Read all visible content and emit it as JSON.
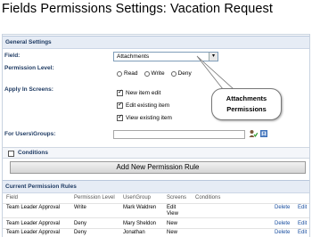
{
  "page": {
    "title": "Fields Permissions Settings: Vacation Request"
  },
  "general": {
    "heading": "General Settings",
    "field_label": "Field:",
    "field_value": "Attachments",
    "permission_label": "Permission Level:",
    "permission_options": [
      "Read",
      "Write",
      "Deny"
    ],
    "apply_label": "Apply In Screens:",
    "screens": [
      {
        "label": "New item edit",
        "checked": true
      },
      {
        "label": "Edit existing item",
        "checked": true
      },
      {
        "label": "View existing item",
        "checked": true
      }
    ],
    "users_label": "For Users\\Groups:"
  },
  "callout": {
    "line1": "Attachments",
    "line2": "Permissions"
  },
  "conditions": {
    "label": "Conditions"
  },
  "add_rule": {
    "label": "Add New Permission Rule"
  },
  "rules": {
    "heading": "Current Permission Rules",
    "columns": [
      "Field",
      "Permission Level",
      "User\\Group",
      "Screens",
      "Conditions"
    ],
    "rows": [
      {
        "field": "Team Leader Approval",
        "level": "Write",
        "user": "Mark Waldren",
        "screens1": "Edit",
        "screens2": "View",
        "delete": "Delete",
        "edit": "Edit"
      },
      {
        "field": "Team Leader Approval",
        "level": "Deny",
        "user": "Mary Sheldon",
        "screens1": "New",
        "screens2": "",
        "delete": "Delete",
        "edit": "Edit"
      },
      {
        "field": "Team Leader Approval",
        "level": "Deny",
        "user": "Jonathan",
        "screens1": "New",
        "screens2": "",
        "delete": "Delete",
        "edit": "Edit"
      }
    ]
  }
}
